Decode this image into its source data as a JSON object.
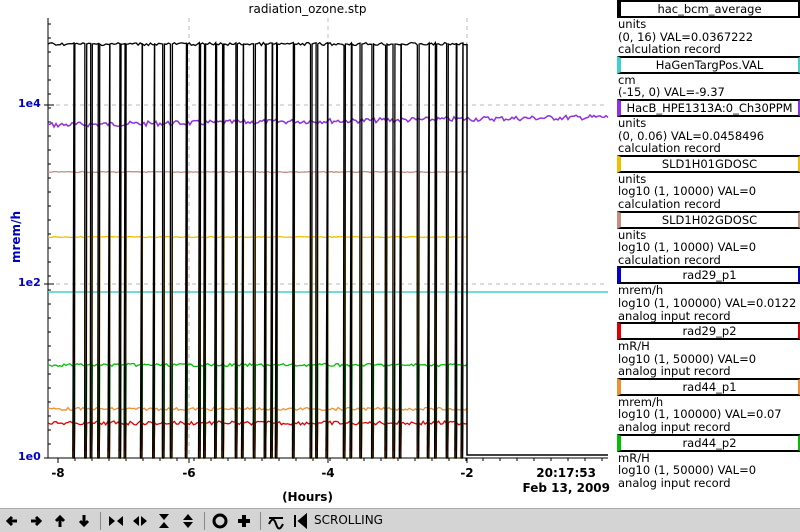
{
  "title": "radiation_ozone.stp",
  "y_axis_label": "mrem/h",
  "x_axis_label": "(Hours)",
  "y_ticks": [
    "1e4",
    "1e2",
    "1e0"
  ],
  "x_ticks": [
    "-8",
    "-6",
    "-4",
    "-2"
  ],
  "timestamp_time": "20:17:53",
  "timestamp_date": "Feb 13, 2009",
  "legend": [
    {
      "name": "hac_bcm_average",
      "color": "#000000",
      "lines": [
        "units",
        "(0, 16) VAL=0.0367222",
        "calculation record"
      ]
    },
    {
      "name": "HaGenTargPos.VAL",
      "color": "#40d0d0",
      "lines": [
        "cm",
        "(-15, 0)  VAL=-9.37"
      ]
    },
    {
      "name": "HacB_HPE1313A:0_Ch30PPM",
      "color": "#9030e0",
      "lines": [
        "units",
        "(0, 0.06) VAL=0.0458496",
        "calculation record"
      ]
    },
    {
      "name": "SLD1H01GDOSC",
      "color": "#f0c000",
      "lines": [
        "units",
        "log10 (1, 10000) VAL=0",
        "calculation record"
      ]
    },
    {
      "name": "SLD1H02GDOSC",
      "color": "#c09080",
      "lines": [
        "units",
        "log10 (1, 10000) VAL=0",
        "calculation record"
      ]
    },
    {
      "name": "rad29_p1",
      "color": "#0000d0",
      "lines": [
        "mrem/h",
        "log10 (1, 100000) VAL=0.0122",
        "analog input record"
      ]
    },
    {
      "name": "rad29_p2",
      "color": "#e00000",
      "lines": [
        "mR/H",
        "log10 (1, 50000) VAL=0",
        "analog input record"
      ]
    },
    {
      "name": "rad44_p1",
      "color": "#f09030",
      "lines": [
        "mrem/h",
        "log10 (1, 100000) VAL=0.07",
        "analog input record"
      ]
    },
    {
      "name": "rad44_p2",
      "color": "#00c000",
      "lines": [
        "mR/H",
        "log10 (1, 50000) VAL=0",
        "analog input record"
      ]
    }
  ],
  "toolbar": {
    "status": "SCROLLING",
    "icons": [
      "arrow-left-icon",
      "arrow-right-icon",
      "arrow-up-icon",
      "arrow-down-icon",
      "zoom-in-x-icon",
      "zoom-out-x-icon",
      "zoom-in-y-icon",
      "zoom-out-y-icon",
      "auto-scale-icon",
      "crosshair-icon",
      "config-icon",
      "scroll-mode-icon"
    ]
  }
}
